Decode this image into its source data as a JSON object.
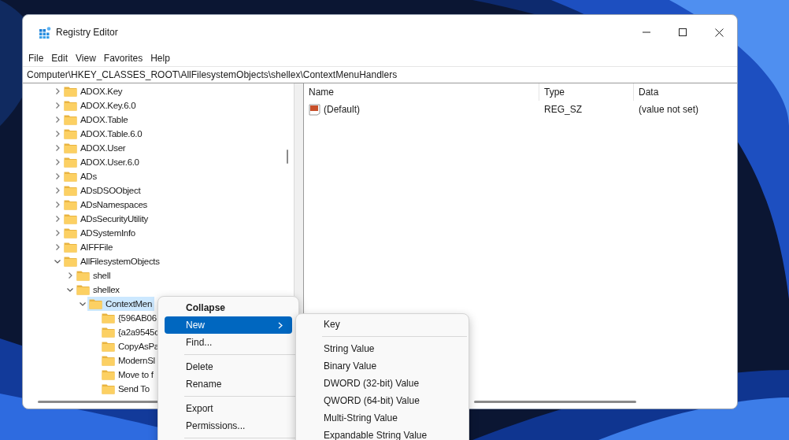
{
  "window": {
    "title": "Registry Editor"
  },
  "menu_bar": [
    "File",
    "Edit",
    "View",
    "Favorites",
    "Help"
  ],
  "address": "Computer\\HKEY_CLASSES_ROOT\\AllFilesystemObjects\\shellex\\ContextMenuHandlers",
  "tree": [
    {
      "label": "ADOX.Key",
      "expanded": false,
      "selected": false
    },
    {
      "label": "ADOX.Key.6.0",
      "expanded": false,
      "selected": false
    },
    {
      "label": "ADOX.Table",
      "expanded": false,
      "selected": false
    },
    {
      "label": "ADOX.Table.6.0",
      "expanded": false,
      "selected": false
    },
    {
      "label": "ADOX.User",
      "expanded": false,
      "selected": false
    },
    {
      "label": "ADOX.User.6.0",
      "expanded": false,
      "selected": false
    },
    {
      "label": "ADs",
      "expanded": false,
      "selected": false
    },
    {
      "label": "ADsDSOObject",
      "expanded": false,
      "selected": false
    },
    {
      "label": "ADsNamespaces",
      "expanded": false,
      "selected": false
    },
    {
      "label": "ADsSecurityUtility",
      "expanded": false,
      "selected": false
    },
    {
      "label": "ADSystemInfo",
      "expanded": false,
      "selected": false
    },
    {
      "label": "AIFFFile",
      "expanded": false,
      "selected": false
    },
    {
      "label": "AllFilesystemObjects",
      "expanded": true,
      "selected": false,
      "children": [
        {
          "label": "shell",
          "expanded": false,
          "selected": false
        },
        {
          "label": "shellex",
          "expanded": true,
          "selected": false,
          "children": [
            {
              "label": "ContextMen",
              "expanded": true,
              "selected": true,
              "children": [
                {
                  "label": "{596AB06",
                  "selected": false
                },
                {
                  "label": "{a2a9545c",
                  "selected": false
                },
                {
                  "label": "CopyAsPa",
                  "selected": false
                },
                {
                  "label": "ModernSl",
                  "selected": false
                },
                {
                  "label": "Move to f",
                  "selected": false
                },
                {
                  "label": "Send To",
                  "selected": false
                }
              ]
            }
          ]
        }
      ]
    }
  ],
  "values_table": {
    "columns": [
      "Name",
      "Type",
      "Data"
    ],
    "rows": [
      {
        "name": "(Default)",
        "type": "REG_SZ",
        "data": "(value not set)"
      }
    ]
  },
  "context_menu": {
    "items": [
      {
        "kind": "command",
        "label": "Collapse",
        "default": true,
        "selected": false
      },
      {
        "kind": "submenu",
        "label": "New",
        "default": false,
        "selected": true
      },
      {
        "kind": "command",
        "label": "Find...",
        "default": false,
        "selected": false
      },
      {
        "kind": "separator"
      },
      {
        "kind": "command",
        "label": "Delete",
        "default": false,
        "selected": false
      },
      {
        "kind": "command",
        "label": "Rename",
        "default": false,
        "selected": false
      },
      {
        "kind": "separator"
      },
      {
        "kind": "command",
        "label": "Export",
        "default": false,
        "selected": false
      },
      {
        "kind": "command",
        "label": "Permissions...",
        "default": false,
        "selected": false
      },
      {
        "kind": "separator"
      }
    ]
  },
  "submenu": {
    "items": [
      {
        "kind": "command",
        "label": "Key",
        "default": false,
        "selected": false
      },
      {
        "kind": "separator"
      },
      {
        "kind": "command",
        "label": "String Value",
        "default": false,
        "selected": false
      },
      {
        "kind": "command",
        "label": "Binary Value",
        "default": false,
        "selected": false
      },
      {
        "kind": "command",
        "label": "DWORD (32-bit) Value",
        "default": false,
        "selected": false
      },
      {
        "kind": "command",
        "label": "QWORD (64-bit) Value",
        "default": false,
        "selected": false
      },
      {
        "kind": "command",
        "label": "Multi-String Value",
        "default": false,
        "selected": false
      },
      {
        "kind": "command",
        "label": "Expandable String Value",
        "default": false,
        "selected": false
      }
    ]
  }
}
